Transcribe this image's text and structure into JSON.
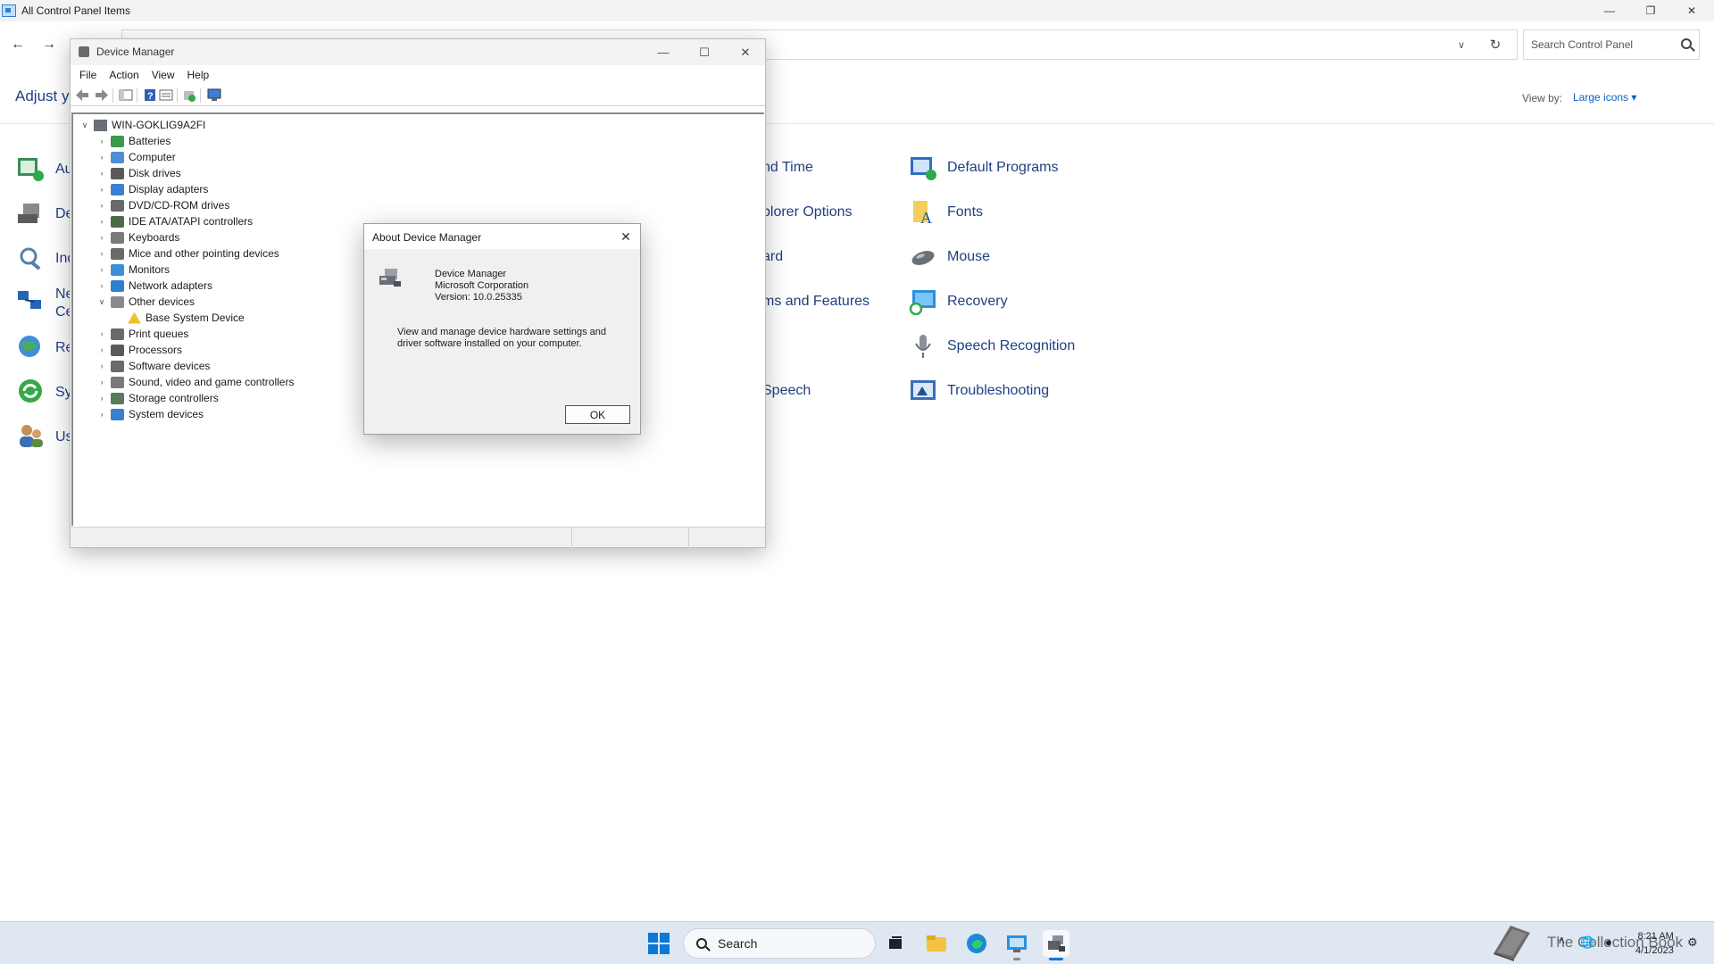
{
  "control_panel": {
    "title": "All Control Panel Items",
    "adjust_text": "Adjust yo",
    "search_placeholder": "Search Control Panel",
    "view_by_label": "View by:",
    "view_by_value": "Large icons ▾",
    "left_items": [
      "Au",
      "De",
      "Ind",
      "Ne",
      "Ce",
      "Re",
      "Sy",
      "Us"
    ],
    "middle_items": [
      "nd Time",
      "plorer Options",
      "ard",
      "ms and Features",
      "Speech"
    ],
    "right_items": [
      "Default Programs",
      "Fonts",
      "Mouse",
      "Recovery",
      "Speech Recognition",
      "Troubleshooting"
    ]
  },
  "device_manager": {
    "title": "Device Manager",
    "menus": [
      "File",
      "Action",
      "View",
      "Help"
    ],
    "root": "WIN-GOKLIG9A2FI",
    "tree": [
      {
        "label": "Batteries",
        "expanded": false
      },
      {
        "label": "Computer",
        "expanded": false
      },
      {
        "label": "Disk drives",
        "expanded": false
      },
      {
        "label": "Display adapters",
        "expanded": false
      },
      {
        "label": "DVD/CD-ROM drives",
        "expanded": false
      },
      {
        "label": "IDE ATA/ATAPI controllers",
        "expanded": false
      },
      {
        "label": "Keyboards",
        "expanded": false
      },
      {
        "label": "Mice and other pointing devices",
        "expanded": false
      },
      {
        "label": "Monitors",
        "expanded": false
      },
      {
        "label": "Network adapters",
        "expanded": false
      },
      {
        "label": "Other devices",
        "expanded": true
      },
      {
        "label": "Base System Device",
        "child": true
      },
      {
        "label": "Print queues",
        "expanded": false
      },
      {
        "label": "Processors",
        "expanded": false
      },
      {
        "label": "Software devices",
        "expanded": false
      },
      {
        "label": "Sound, video and game controllers",
        "expanded": false
      },
      {
        "label": "Storage controllers",
        "expanded": false
      },
      {
        "label": "System devices",
        "expanded": false
      }
    ]
  },
  "about_dialog": {
    "title": "About Device Manager",
    "product": "Device Manager",
    "company": "Microsoft Corporation",
    "version": "Version: 10.0.25335",
    "description": "View and manage device hardware settings and driver software installed on your computer.",
    "ok_label": "OK"
  },
  "taskbar": {
    "search_label": "Search",
    "watermark": "The Collection Book",
    "time": "8:21 AM",
    "date": "4/1/2023"
  },
  "colors": {
    "accent": "#0a78d4",
    "link": "#1f3f83",
    "taskbar": "#dfe7f3"
  }
}
